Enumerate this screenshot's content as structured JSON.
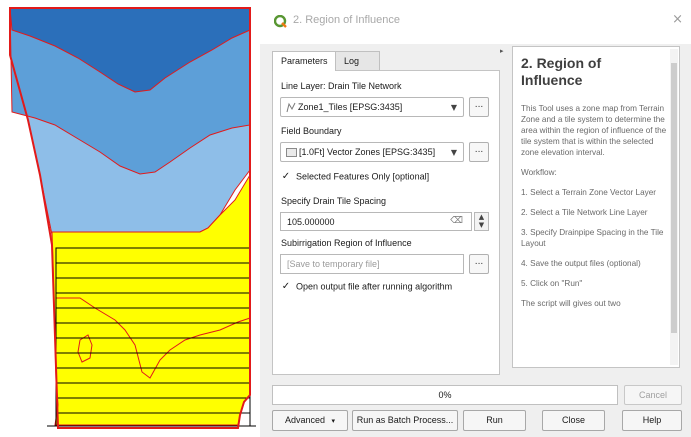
{
  "window": {
    "title": "2. Region of Influence",
    "close_glyph": "×"
  },
  "tabs": [
    {
      "label": "Parameters",
      "active": true
    },
    {
      "label": "Log",
      "active": false
    }
  ],
  "params": {
    "line_layer_label": "Line Layer: Drain Tile Network",
    "line_layer_value": "Zone1_Tiles [EPSG:3435]",
    "field_boundary_label": "Field Boundary",
    "field_boundary_value": "[1.0Ft] Vector Zones [EPSG:3435]",
    "selected_only_label": "Selected Features Only [optional]",
    "selected_only_checked": true,
    "spacing_label": "Specify Drain Tile Spacing",
    "spacing_value": "105.000000",
    "roi_label": "Subirrigation Region of Influence",
    "roi_placeholder": "[Save to temporary file]",
    "open_output_label": "Open output file after running algorithm",
    "open_output_checked": true,
    "browse_label": "...",
    "check_glyph": "✓"
  },
  "help": {
    "title": "2. Region of Influence",
    "paragraphs": [
      "This Tool uses a zone map from Terrain Zone and a tile system to determine the area within the region of influence of the tile system that is within the selected zone elevation interval.",
      "Workflow:",
      "1. Select a Terrain Zone Vector Layer",
      "2. Select a Tile Network Line Layer",
      "3. Specify Drainpipe Spacing in the Tile Layout",
      "4. Save the output files (optional)",
      "5. Click on \"Run\"",
      "The script will gives out two"
    ]
  },
  "progress": {
    "value": 0,
    "text": "0%"
  },
  "buttons": {
    "cancel": "Cancel",
    "advanced": "Advanced",
    "batch": "Run as Batch Process...",
    "run": "Run",
    "close": "Close",
    "help": "Help"
  },
  "icons": {
    "app": "qgis-logo-icon",
    "line_layer": "line-layer-icon",
    "polygon_layer": "polygon-layer-icon",
    "clear": "clear-field-icon"
  },
  "colors": {
    "zone_dark_blue": "#2b6fba",
    "zone_blue": "#5d9fd8",
    "zone_light_blue": "#8ebee8",
    "zone_yellow": "#ffff00",
    "zone_border": "#e21a1a",
    "progress_fill": "#3daee9"
  }
}
